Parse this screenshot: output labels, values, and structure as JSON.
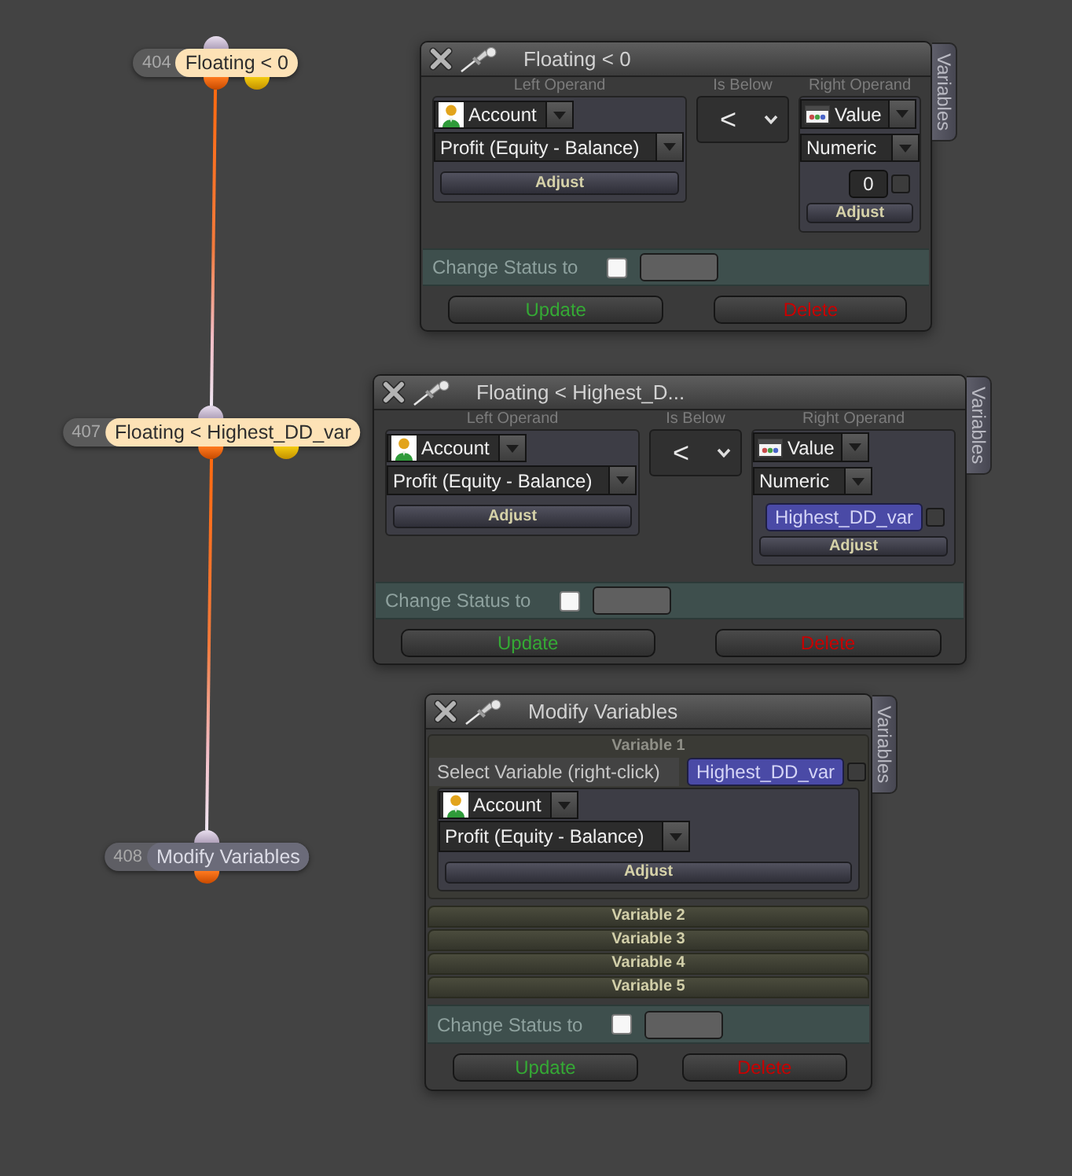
{
  "nodes": [
    {
      "number": "404",
      "label": "Floating < 0",
      "kind": "condition"
    },
    {
      "number": "407",
      "label": "Floating < Highest_DD_var",
      "kind": "condition"
    },
    {
      "number": "408",
      "label": "Modify Variables",
      "kind": "action"
    }
  ],
  "panels": [
    {
      "kind": "condition",
      "title": "Floating < 0",
      "side_tab": "Variables",
      "left_operand": {
        "heading": "Left Operand",
        "source": {
          "kind": "account",
          "text": "Account"
        },
        "field": "Profit (Equity - Balance)",
        "adjust": "Adjust"
      },
      "comparator": {
        "heading": "Is Below",
        "value": "<"
      },
      "right_operand": {
        "heading": "Right Operand",
        "source": {
          "kind": "value",
          "text": "Value"
        },
        "type": "Numeric",
        "value": {
          "kind": "number",
          "text": "0"
        },
        "checked": false,
        "adjust": "Adjust"
      },
      "status": {
        "label": "Change Status to",
        "checked": false
      },
      "buttons": {
        "update": "Update",
        "delete": "Delete"
      }
    },
    {
      "kind": "condition",
      "title": "Floating < Highest_D...",
      "side_tab": "Variables",
      "left_operand": {
        "heading": "Left Operand",
        "source": {
          "kind": "account",
          "text": "Account"
        },
        "field": "Profit (Equity - Balance)",
        "adjust": "Adjust"
      },
      "comparator": {
        "heading": "Is Below",
        "value": "<"
      },
      "right_operand": {
        "heading": "Right Operand",
        "source": {
          "kind": "value",
          "text": "Value"
        },
        "type": "Numeric",
        "value": {
          "kind": "variable",
          "text": "Highest_DD_var"
        },
        "checked": false,
        "adjust": "Adjust"
      },
      "status": {
        "label": "Change Status to",
        "checked": false
      },
      "buttons": {
        "update": "Update",
        "delete": "Delete"
      }
    },
    {
      "kind": "modify",
      "title": "Modify Variables",
      "side_tab": "Variables",
      "variables": [
        {
          "title": "Variable 1",
          "expanded": true,
          "select_label": "Select Variable (right-click)",
          "variable": "Highest_DD_var",
          "checked": false,
          "source": {
            "kind": "account",
            "text": "Account"
          },
          "field": "Profit (Equity - Balance)",
          "adjust": "Adjust"
        },
        {
          "title": "Variable 2",
          "expanded": false
        },
        {
          "title": "Variable 3",
          "expanded": false
        },
        {
          "title": "Variable 4",
          "expanded": false
        },
        {
          "title": "Variable 5",
          "expanded": false
        }
      ],
      "status": {
        "label": "Change Status to",
        "checked": false
      },
      "buttons": {
        "update": "Update",
        "delete": "Delete"
      }
    }
  ]
}
